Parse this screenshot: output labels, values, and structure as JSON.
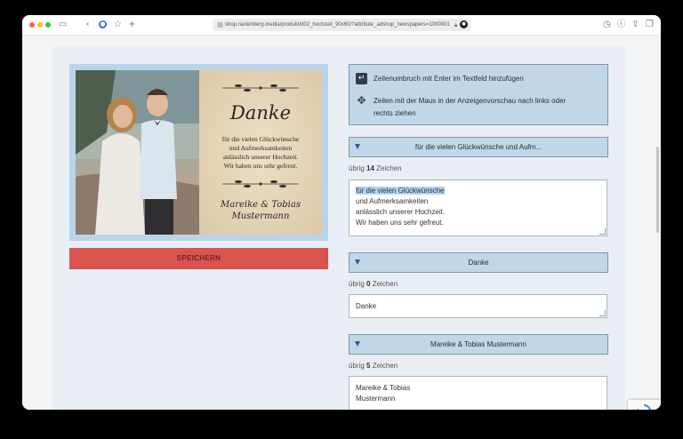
{
  "browser": {
    "url": "shop.rautenberg.media/produkt/d02_hochzeit_90x60/?attribute_adshop_newspapers=1000001",
    "traffic_lights": [
      "#ff5f57",
      "#febc2e",
      "#28c840"
    ]
  },
  "editor": {
    "save_label": "SPEICHERN",
    "info": {
      "line_break_hint": "Zeilenumbruch mit Enter im Textfeld hinzufügen",
      "drag_hint_line1": "Zeilen mit der Maus in der Anzeigenvorschau nach links oder",
      "drag_hint_line2": "rechts ziehen"
    },
    "fields": [
      {
        "title": "für die vielen Glückwünsche und Aufm...",
        "counter_prefix": "übrig",
        "remaining": "14",
        "counter_suffix": "Zeichen",
        "lines": [
          "für die vielen Glückwünsche",
          "und Aufmerksamkeiten",
          "anlässlich unserer Hochzeit.",
          "Wir haben uns sehr gefreut."
        ]
      },
      {
        "title": "Danke",
        "counter_prefix": "übrig",
        "remaining": "0",
        "counter_suffix": "Zeichen",
        "lines": [
          "Danke"
        ]
      },
      {
        "title": "Mareike & Tobias Mustermann",
        "counter_prefix": "übrig",
        "remaining": "5",
        "counter_suffix": "Zeichen",
        "lines": [
          "Mareike & Tobias",
          "Mustermann"
        ]
      }
    ]
  },
  "preview": {
    "title": "Danke",
    "message_lines": [
      "für die vielen Glückwünsche",
      "und Aufmerksamkeiten",
      "anlässlich unserer Hochzeit.",
      "Wir haben uns sehr gefreut."
    ],
    "names_line1": "Mareike & Tobias",
    "names_line2": "Mustermann"
  },
  "colors": {
    "save_button": "#d9534f",
    "accordion_header": "#c1d6e6",
    "accent_arrow": "#1e5fa0"
  }
}
